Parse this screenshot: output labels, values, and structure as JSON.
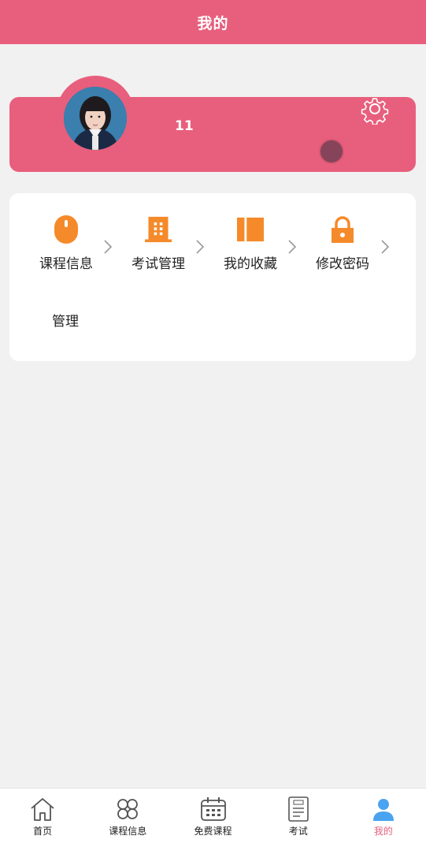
{
  "header": {
    "title": "我的"
  },
  "profile": {
    "username": "11",
    "settings_icon": "gear-icon"
  },
  "menu": {
    "items": [
      {
        "label": "课程信息",
        "icon": "mouse-icon"
      },
      {
        "label": "考试管理",
        "icon": "building-icon"
      },
      {
        "label": "我的收藏",
        "icon": "book-icon"
      },
      {
        "label": "修改密码",
        "icon": "lock-icon"
      }
    ],
    "extra_label": "管理"
  },
  "bottom_nav": {
    "items": [
      {
        "label": "首页",
        "icon": "home-icon"
      },
      {
        "label": "课程信息",
        "icon": "clover-icon"
      },
      {
        "label": "免费课程",
        "icon": "calendar-icon"
      },
      {
        "label": "考试",
        "icon": "exam-paper-icon"
      },
      {
        "label": "我的",
        "icon": "user-icon"
      }
    ],
    "active": "我的"
  },
  "colors": {
    "brand": "#e85f7d",
    "accent_icon": "#f58a2a",
    "active_nav_icon": "#4aa3f0"
  }
}
